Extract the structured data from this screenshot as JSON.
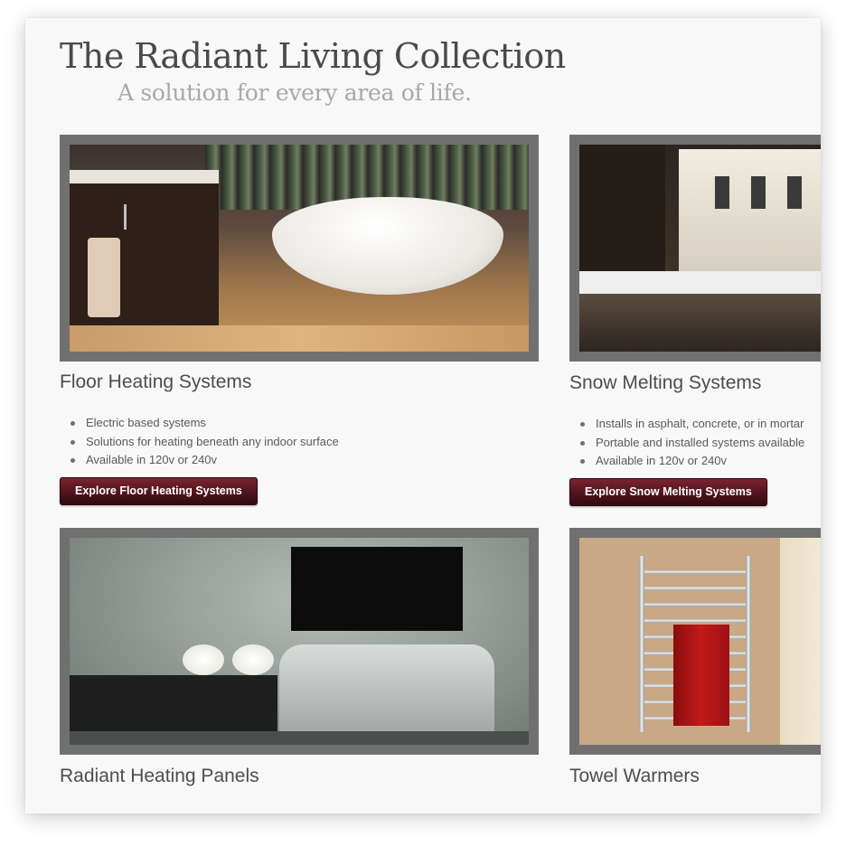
{
  "header": {
    "title": "The Radiant Living Collection",
    "subtitle": "A solution for every area of life."
  },
  "products": [
    {
      "title": "Floor Heating Systems",
      "image": "bathroom-with-freestanding-tub-photo",
      "features": [
        "Electric based systems",
        "Solutions for heating beneath any indoor surface",
        "Available in 120v or 240v"
      ],
      "button_label": "Explore Floor Heating Systems"
    },
    {
      "title": "Snow Melting Systems",
      "image": "snowy-house-driveway-photo",
      "features": [
        "Installs in asphalt, concrete, or in mortar",
        "Portable and installed systems available",
        "Available in 120v or 240v"
      ],
      "button_label": "Explore Snow Melting Systems"
    },
    {
      "title": "Radiant Heating Panels",
      "image": "living-room-wall-panel-photo"
    },
    {
      "title": "Towel Warmers",
      "image": "towel-warmer-with-red-towel-photo"
    }
  ],
  "colors": {
    "button_gradient_top": "#7a2530",
    "button_gradient_bottom": "#320a10",
    "photo_frame": "#707070",
    "title_text": "#4a4a4a",
    "subtitle_text": "#a8a8a8"
  }
}
